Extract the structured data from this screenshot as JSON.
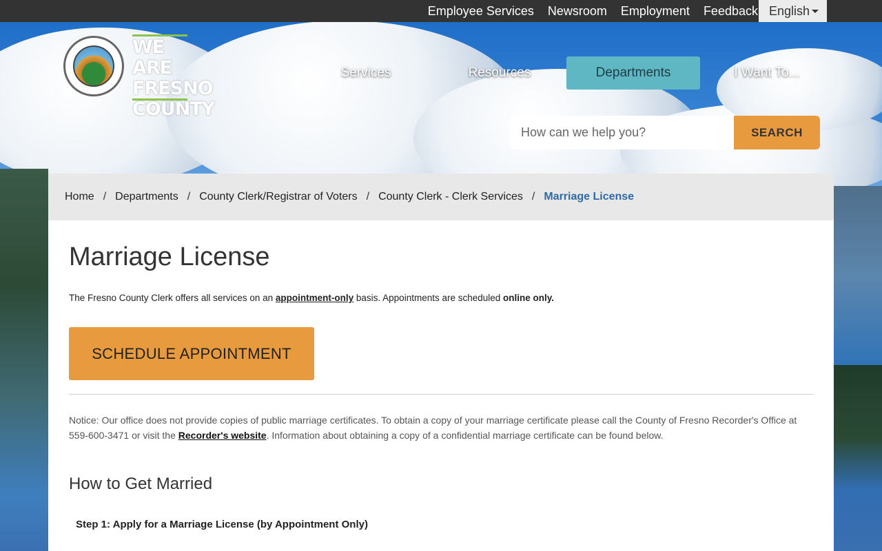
{
  "topbar": {
    "links": [
      "Employee Services",
      "Newsroom",
      "Employment",
      "Feedback"
    ],
    "language": "English"
  },
  "logo": {
    "seal_text": "THE COUNTY OF FRESNO",
    "wordmark": [
      "WE ARE",
      "FRESNO",
      "COUNTY"
    ]
  },
  "nav": {
    "items": [
      "Services",
      "Resources",
      "Departments",
      "I Want To..."
    ],
    "active": "Departments"
  },
  "search": {
    "placeholder": "How can we help you?",
    "button_label": "SEARCH"
  },
  "breadcrumb": {
    "items": [
      "Home",
      "Departments",
      "County Clerk/Registrar of Voters",
      "County Clerk - Clerk Services"
    ],
    "current": "Marriage License"
  },
  "page": {
    "title": "Marriage License",
    "intro_pre": "The Fresno County Clerk offers all services on an ",
    "intro_link": "appointment-only",
    "intro_mid": " basis. Appointments are scheduled ",
    "intro_bold": "online only.",
    "cta_label": "SCHEDULE APPOINTMENT",
    "notice_pre": "Notice: Our office does not provide copies of public marriage certificates. To obtain a copy of your marriage certificate please call the County of Fresno Recorder's Office at 559-600-3471 or visit the ",
    "notice_link": "Recorder's website",
    "notice_post": ". Information about obtaining a copy of a confidential marriage certificate can be found below.",
    "section_heading": "How to Get Married",
    "step1": "Step 1: Apply for a Marriage License (by Appointment Only)"
  },
  "colors": {
    "accent_orange": "#e89b3e",
    "nav_active": "#5fb7c4",
    "breadcrumb_current": "#2f6aa3",
    "topbar": "#333333"
  }
}
